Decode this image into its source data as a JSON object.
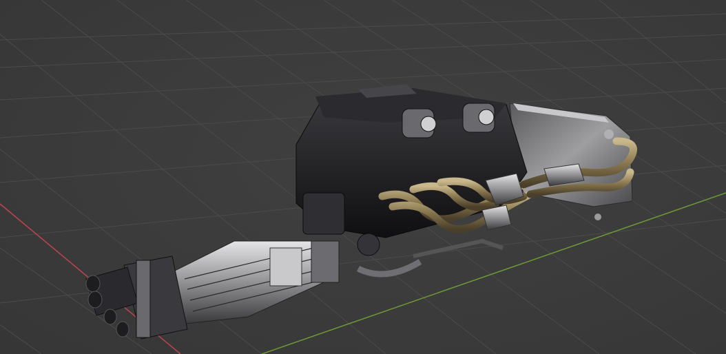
{
  "viewport": {
    "mode": "3d-viewport",
    "background_color": "#3d3d3d",
    "grid_color": "#4a4a4a",
    "x_axis_color": "#c0444f",
    "y_axis_color": "#6e9a35"
  },
  "scene": {
    "object": "engine-with-transmission-and-exhaust",
    "parts": [
      "engine-block",
      "intake-plenum",
      "throttle-bodies",
      "exhaust-headers",
      "muffler",
      "transmission",
      "drive-shaft"
    ],
    "colors": {
      "engine": "#1a1a1c",
      "metal": "#b9b9bb",
      "headers": "#8c7b55",
      "muffler": "#8e8e90"
    }
  }
}
